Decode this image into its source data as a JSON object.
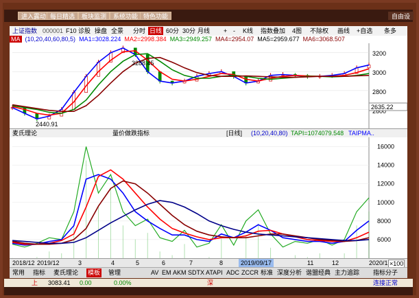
{
  "topbar": {
    "buttons": [
      "进入露动",
      "每日精选",
      "板块监测",
      "系统功能",
      "特色功能",
      "自由设"
    ]
  },
  "toolbar": {
    "title": "上证指数",
    "code": "000001",
    "items": [
      "F10",
      "诊股",
      "操盘",
      "全景",
      "分时",
      "日线",
      "60分",
      "30分",
      "月线"
    ],
    "selected": "日线",
    "right_items": [
      "+",
      "-",
      "K线",
      "指数叠加",
      "4图",
      "不除权",
      "画线",
      "+自选",
      "条多"
    ]
  },
  "ma_bar": {
    "label": "MA",
    "params": "(10,20,40,60,80,5)",
    "ma1": "MA1=3028.224",
    "ma2": "MA2=2998.384",
    "ma3": "MA3=2949.257",
    "ma4": "MA4=2954.07",
    "ma5": "MA5=2959.677",
    "ma6": "MA6=3068.507"
  },
  "price_chart": {
    "y_ticks": [
      "3200",
      "3000",
      "2800",
      "2600"
    ],
    "current": "2635.22",
    "high_label": "3288.45",
    "low_label": "2440.91"
  },
  "indicator": {
    "name": "麦氏理论",
    "subtitle": "量价做跌指标",
    "mode": "[日线]",
    "params": "(10,20,40,80)",
    "tapi": "TAPI=1074079.548",
    "taipma": "TAIPMA..",
    "y_ticks": [
      "16000",
      "14000",
      "12000",
      "10000",
      "8000",
      "6000"
    ]
  },
  "axis": {
    "labels": [
      "2018/12",
      "2019/12",
      "3",
      "4",
      "5",
      "6",
      "7",
      "8",
      "2019/09/17",
      "11",
      "12",
      "2020/1"
    ],
    "zoom": "×100"
  },
  "tabs": {
    "items": [
      "常用",
      "指标",
      "麦氏理论",
      "模板",
      "管理",
      "AV",
      "EM",
      "AKM",
      "SDTX",
      "ATAPI",
      "ADC",
      "ZCCR",
      "标准",
      "深度分析",
      "谐盟经典",
      "主力追踪",
      "指标分子"
    ],
    "active": "模板"
  },
  "status": {
    "market": "上",
    "index_value": "3083.41",
    "change": "0.00",
    "pct": "0.00%",
    "market2": "深",
    "conn": "连接正常"
  },
  "chart_data": [
    {
      "type": "line",
      "title": "上证指数",
      "ylim": [
        2400,
        3300
      ],
      "series": [
        {
          "name": "MA1",
          "values": [
            2620,
            2560,
            2500,
            2530,
            2600,
            2780,
            2950,
            3100,
            3200,
            3250,
            3180,
            3000,
            2900,
            2880,
            2900,
            2950,
            2980,
            3000,
            2950,
            2880,
            2900,
            2960,
            2970,
            2960,
            2950,
            2950,
            2960,
            2980,
            3040,
            3070
          ]
        },
        {
          "name": "MA2",
          "values": [
            2630,
            2600,
            2560,
            2540,
            2560,
            2680,
            2850,
            3000,
            3120,
            3210,
            3220,
            3120,
            3000,
            2920,
            2900,
            2920,
            2950,
            2980,
            2970,
            2920,
            2900,
            2930,
            2950,
            2960,
            2955,
            2950,
            2950,
            2960,
            2990,
            3030
          ]
        },
        {
          "name": "MA3",
          "values": [
            2640,
            2620,
            2600,
            2570,
            2560,
            2600,
            2700,
            2860,
            3000,
            3110,
            3180,
            3190,
            3110,
            3020,
            2960,
            2930,
            2930,
            2950,
            2960,
            2950,
            2930,
            2920,
            2930,
            2940,
            2950,
            2950,
            2945,
            2950,
            2960,
            2980
          ]
        },
        {
          "name": "MA4",
          "values": [
            2650,
            2630,
            2610,
            2590,
            2580,
            2580,
            2640,
            2750,
            2880,
            3000,
            3090,
            3140,
            3150,
            3100,
            3040,
            2990,
            2960,
            2950,
            2950,
            2955,
            2950,
            2945,
            2940,
            2940,
            2945,
            2950,
            2950,
            2950,
            2955,
            2960
          ]
        }
      ]
    },
    {
      "type": "line",
      "title": "麦氏理论",
      "ylim": [
        4000,
        17000
      ],
      "series": [
        {
          "name": "TAPI",
          "values": [
            5500,
            5200,
            5600,
            6200,
            6000,
            9000,
            16000,
            11000,
            13000,
            9000,
            7500,
            8200,
            6200,
            5800,
            7000,
            5200,
            5600,
            7600,
            5400,
            8000,
            9200,
            6600,
            5200,
            5800,
            5600,
            6000,
            5400,
            6000,
            9000,
            10500
          ]
        },
        {
          "name": "TAIPMA1",
          "values": [
            5600,
            5400,
            5500,
            5800,
            6000,
            7500,
            12500,
            13000,
            12500,
            11000,
            9000,
            8000,
            7200,
            6500,
            6500,
            6000,
            5800,
            6600,
            6200,
            6800,
            7600,
            7000,
            6200,
            6000,
            5800,
            5800,
            5600,
            5800,
            7000,
            8000
          ]
        },
        {
          "name": "TAIPMA2",
          "values": [
            5700,
            5500,
            5500,
            5600,
            5900,
            6600,
            9500,
            12800,
            13500,
            12500,
            11000,
            9500,
            8200,
            7200,
            6700,
            6300,
            6000,
            6200,
            6200,
            6400,
            6900,
            7000,
            6600,
            6300,
            6000,
            5900,
            5800,
            5800,
            6200,
            6800
          ]
        },
        {
          "name": "TAIPMA3",
          "values": [
            5800,
            5600,
            5500,
            5500,
            5600,
            6000,
            7200,
            9600,
            11500,
            12300,
            12000,
            11000,
            9800,
            8600,
            7600,
            6900,
            6500,
            6300,
            6200,
            6200,
            6400,
            6600,
            6600,
            6400,
            6200,
            6000,
            5900,
            5800,
            5900,
            6200
          ]
        },
        {
          "name": "TAIPMA4",
          "values": [
            5900,
            5800,
            5700,
            5600,
            5600,
            5700,
            6200,
            7000,
            7800,
            8500,
            9200,
            9800,
            10200,
            10000,
            9500,
            8800,
            8000,
            7500,
            7100,
            6800,
            6600,
            6500,
            6400,
            6300,
            6200,
            6100,
            6000,
            5900,
            5900,
            6000
          ]
        }
      ]
    }
  ]
}
